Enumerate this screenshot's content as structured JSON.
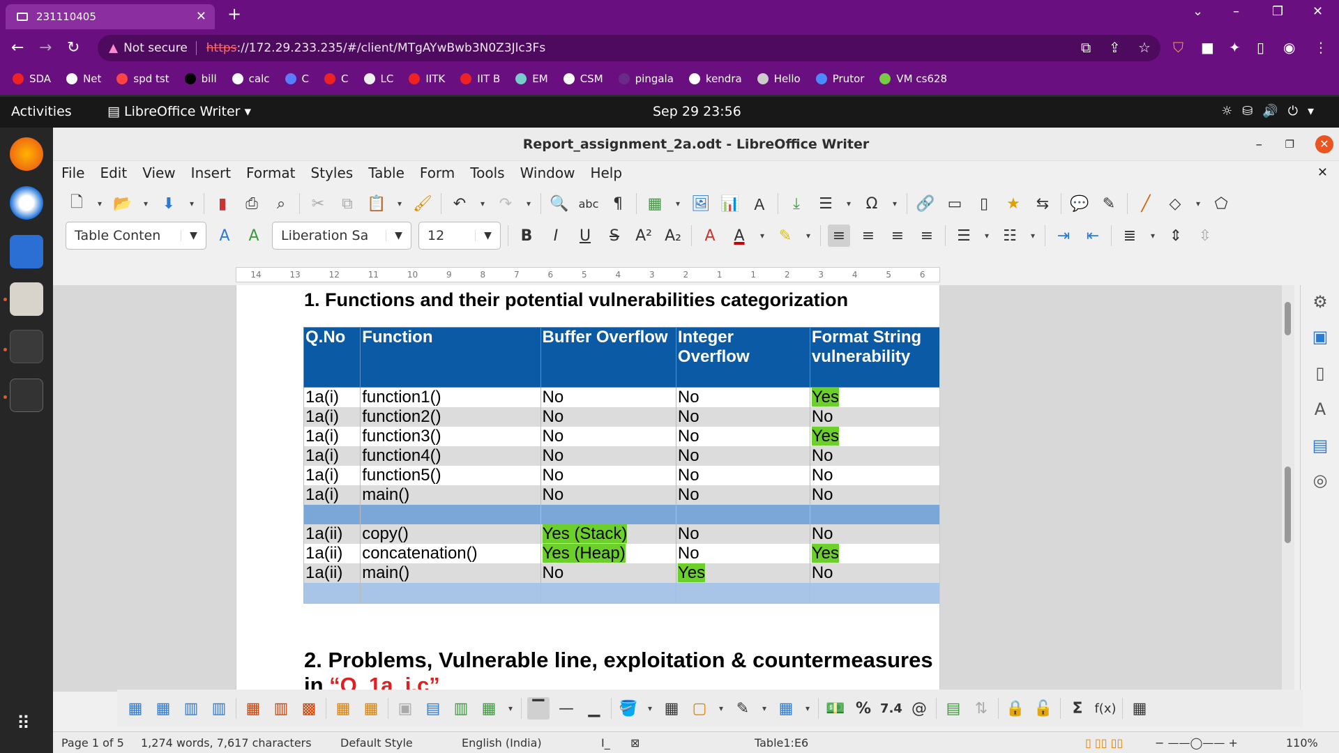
{
  "browser": {
    "tab_title": "231110405",
    "not_secure": "Not secure",
    "url_scheme": "https",
    "url_rest": "://172.29.233.235/#/client/MTgAYwBwb3N0Z3Jlc3Fs",
    "bookmarks": [
      "SDA",
      "Net",
      "spd tst",
      "bill",
      "calc",
      "C",
      "C",
      "LC",
      "IITK",
      "IIT B",
      "EM",
      "CSM",
      "pingala",
      "kendra",
      "Hello",
      "Prutor",
      "VM cs628"
    ]
  },
  "gnome": {
    "activities": "Activities",
    "app_name": "LibreOffice Writer",
    "clock": "Sep 29  23:56"
  },
  "writer": {
    "title": "Report_assignment_2a.odt - LibreOffice Writer",
    "menu": [
      "File",
      "Edit",
      "View",
      "Insert",
      "Format",
      "Styles",
      "Table",
      "Form",
      "Tools",
      "Window",
      "Help"
    ],
    "para_style": "Table Conten",
    "font_name": "Liberation Sa",
    "font_size": "12",
    "ruler_ticks": [
      "14",
      "13",
      "12",
      "11",
      "10",
      "9",
      "8",
      "7",
      "6",
      "5",
      "4",
      "3",
      "2",
      "1",
      "1",
      "2",
      "3",
      "4",
      "5",
      "6"
    ]
  },
  "document": {
    "heading1": "1. Functions and their potential vulnerabilities categorization",
    "heading2_line1": "2. Problems, Vulnerable line, exploitation & countermeasures",
    "heading2_line2_prefix": "in ",
    "heading2_line2_red": "“Q_1a_i.c”",
    "table": {
      "headers": [
        "Q.No",
        "Function",
        "Buffer Overflow",
        "Integer Overflow",
        "Format String vulnerability"
      ],
      "rows_part1": [
        [
          "1a(i)",
          "function1()",
          "No",
          "No",
          "Yes"
        ],
        [
          "1a(i)",
          "function2()",
          "No",
          "No",
          "No"
        ],
        [
          "1a(i)",
          "function3()",
          "No",
          "No",
          "Yes"
        ],
        [
          "1a(i)",
          "function4()",
          "No",
          "No",
          "No"
        ],
        [
          "1a(i)",
          "function5()",
          "No",
          "No",
          "No"
        ],
        [
          "1a(i)",
          "main()",
          "No",
          "No",
          "No"
        ]
      ],
      "rows_part2": [
        [
          "1a(ii)",
          "copy()",
          "Yes (Stack)",
          "No",
          "No"
        ],
        [
          "1a(ii)",
          "concatenation()",
          "Yes (Heap)",
          "No",
          "Yes"
        ],
        [
          "1a(ii)",
          "main()",
          "No",
          "Yes",
          "No"
        ]
      ]
    }
  },
  "status": {
    "page": "Page 1 of 5",
    "words": "1,274 words, 7,617 characters",
    "page_style": "Default Style",
    "language": "English (India)",
    "cell": "Table1:E6",
    "zoom": "110%"
  },
  "colors": {
    "header_blue": "#0b5aa6",
    "highlight_green": "#6bd12a",
    "browser_purple": "#6a0f80"
  }
}
